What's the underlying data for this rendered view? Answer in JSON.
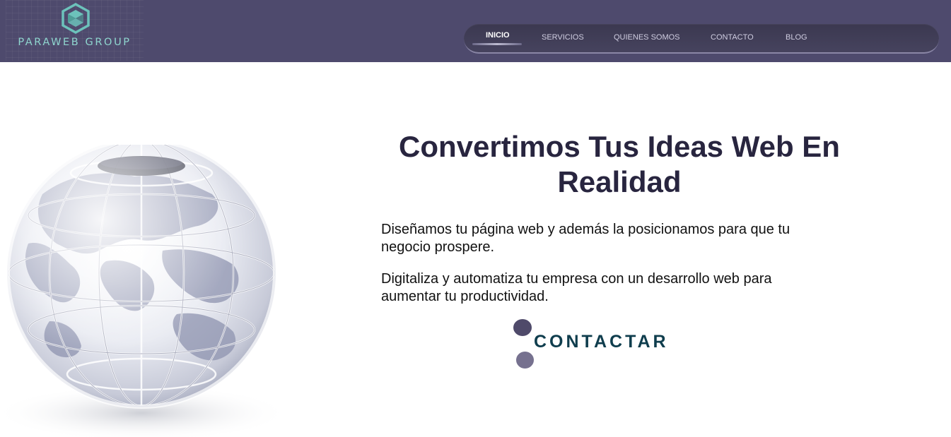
{
  "brand": {
    "name": "PARAWEB GROUP",
    "logo_icon": "hexagon-s-logo-icon",
    "logo_color": "#6cc2bb"
  },
  "nav": {
    "items": [
      {
        "label": "INICIO",
        "active": true
      },
      {
        "label": "SERVICIOS",
        "active": false
      },
      {
        "label": "QUIENES SOMOS",
        "active": false
      },
      {
        "label": "CONTACTO",
        "active": false
      },
      {
        "label": "BLOG",
        "active": false
      }
    ]
  },
  "hero": {
    "title": "Convertimos Tus Ideas Web En Realidad",
    "paragraph_1": "Diseñamos tu página web y además la posicionamos para que tu negocio prospere.",
    "paragraph_2": "Digitaliza y automatiza tu empresa con un desarrollo web para aumentar tu productividad.",
    "cta_label": "CONTACTAR",
    "image_icon": "glass-globe-illustration"
  },
  "colors": {
    "header_bg": "#4e4a6d",
    "title_color": "#28253f",
    "cta_color": "#0f3d4d",
    "accent_teal": "#8fd6cf"
  }
}
